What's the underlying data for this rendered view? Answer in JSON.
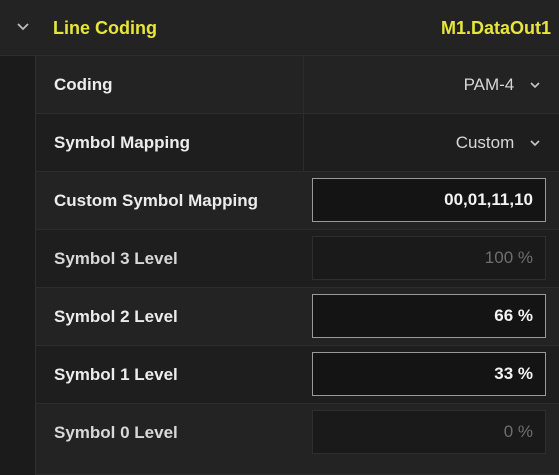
{
  "header": {
    "title": "Line Coding",
    "target": "M1.DataOut1",
    "expand_icon": "chevron-down-icon",
    "accent_color": "#e6e63a"
  },
  "rows": [
    {
      "label": "Coding",
      "type": "dropdown",
      "value": "PAM-4"
    },
    {
      "label": "Symbol Mapping",
      "type": "dropdown",
      "value": "Custom"
    },
    {
      "label": "Custom Symbol Mapping",
      "type": "input",
      "value": "00,01,11,10"
    },
    {
      "label": "Symbol 3 Level",
      "type": "input",
      "value": "100 %",
      "disabled": true
    },
    {
      "label": "Symbol 2 Level",
      "type": "input",
      "value": "66 %"
    },
    {
      "label": "Symbol 1 Level",
      "type": "input",
      "value": "33 %"
    },
    {
      "label": "Symbol 0 Level",
      "type": "input",
      "value": "0 %",
      "disabled": true
    }
  ]
}
